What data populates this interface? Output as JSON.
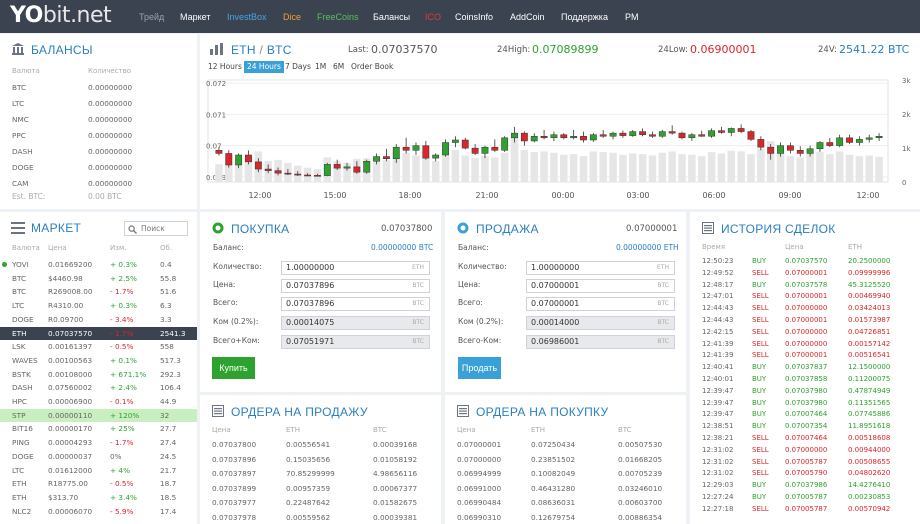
{
  "logo": {
    "yo": "YO",
    "bit": "bit",
    "net": ".net"
  },
  "nav": [
    {
      "label": "Трейд",
      "color": "#9aa0a8"
    },
    {
      "label": "Маркет",
      "color": "#ffffff"
    },
    {
      "label": "InvestBox",
      "color": "#4aa3e0"
    },
    {
      "label": "Dice",
      "color": "#f0a030"
    },
    {
      "label": "FreeCoins",
      "color": "#5ac05a"
    },
    {
      "label": "Балансы",
      "color": "#ffffff"
    },
    {
      "label": "ICO",
      "color": "#e03a3a"
    },
    {
      "label": "CoinsInfo",
      "color": "#ffffff"
    },
    {
      "label": "AddCoin",
      "color": "#ffffff"
    },
    {
      "label": "Поддержка",
      "color": "#ffffff"
    },
    {
      "label": "PM",
      "color": "#ffffff"
    }
  ],
  "balances": {
    "title": "БАЛАНСЫ",
    "col_currency": "Валюта",
    "col_amount": "Количество",
    "rows": [
      {
        "coin": "BTC",
        "amount": "0.00000000"
      },
      {
        "coin": "LTC",
        "amount": "0.00000000"
      },
      {
        "coin": "NMC",
        "amount": "0.00000000"
      },
      {
        "coin": "PPC",
        "amount": "0.00000000"
      },
      {
        "coin": "DASH",
        "amount": "0.00000000"
      },
      {
        "coin": "DOGE",
        "amount": "0.00000000"
      },
      {
        "coin": "CAM",
        "amount": "0.00000000"
      }
    ],
    "est_label": "Est. BTC:",
    "est_value": "0.00 BTC"
  },
  "market": {
    "title": "МАРКЕТ",
    "search_placeholder": "Поиск",
    "headers": [
      "Валюта",
      "Цена",
      "Изм.",
      "Об."
    ],
    "rows": [
      {
        "coin": "YOVI",
        "price": "0.01669200",
        "change": "+ 0.3%",
        "vol": "0.4",
        "dir": "up",
        "hl": ""
      },
      {
        "coin": "BTC",
        "price": "$4460.98",
        "change": "+ 2.5%",
        "vol": "55.8",
        "dir": "up",
        "hl": ""
      },
      {
        "coin": "BTC",
        "price": "R269008.00",
        "change": "- 1.7%",
        "vol": "51.6",
        "dir": "down",
        "hl": ""
      },
      {
        "coin": "LTC",
        "price": "R4310.00",
        "change": "+ 0.3%",
        "vol": "6.3",
        "dir": "up",
        "hl": ""
      },
      {
        "coin": "DOGE",
        "price": "R0.09700",
        "change": "- 3.4%",
        "vol": "3.3",
        "dir": "down",
        "hl": ""
      },
      {
        "coin": "ETH",
        "price": "0.07037570",
        "change": "- 1.7%",
        "vol": "2541.3",
        "dir": "down",
        "hl": "sel"
      },
      {
        "coin": "LSK",
        "price": "0.00161397",
        "change": "- 0.5%",
        "vol": "558",
        "dir": "down",
        "hl": ""
      },
      {
        "coin": "WAVES",
        "price": "0.00100563",
        "change": "+ 0.1%",
        "vol": "517.3",
        "dir": "up",
        "hl": ""
      },
      {
        "coin": "BSTK",
        "price": "0.00108000",
        "change": "+ 671.1%",
        "vol": "292.3",
        "dir": "up",
        "hl": ""
      },
      {
        "coin": "DASH",
        "price": "0.07560002",
        "change": "+ 2.4%",
        "vol": "106.4",
        "dir": "up",
        "hl": ""
      },
      {
        "coin": "HPC",
        "price": "0.00006900",
        "change": "- 0.1%",
        "vol": "44.9",
        "dir": "down",
        "hl": ""
      },
      {
        "coin": "STP",
        "price": "0.00000110",
        "change": "+ 120%",
        "vol": "32",
        "dir": "up",
        "hl": "green"
      },
      {
        "coin": "BIT16",
        "price": "0.00000170",
        "change": "+ 25%",
        "vol": "27.7",
        "dir": "up",
        "hl": ""
      },
      {
        "coin": "PING",
        "price": "0.00004293",
        "change": "- 1.7%",
        "vol": "27.4",
        "dir": "down",
        "hl": ""
      },
      {
        "coin": "DOGE",
        "price": "0.00000037",
        "change": "0%",
        "vol": "24.5",
        "dir": "flat",
        "hl": ""
      },
      {
        "coin": "LTC",
        "price": "0.01612000",
        "change": "+ 4%",
        "vol": "21.7",
        "dir": "up",
        "hl": ""
      },
      {
        "coin": "ETH",
        "price": "R18775.00",
        "change": "- 0.5%",
        "vol": "18.7",
        "dir": "down",
        "hl": ""
      },
      {
        "coin": "ETH",
        "price": "$313.70",
        "change": "+ 3.4%",
        "vol": "18.5",
        "dir": "up",
        "hl": ""
      },
      {
        "coin": "NLC2",
        "price": "0.00006070",
        "change": "- 5.9%",
        "vol": "17.4",
        "dir": "down",
        "hl": ""
      }
    ]
  },
  "ticker": {
    "base": "ETH",
    "slash": "/",
    "quote": "BTC",
    "last_label": "Last:",
    "last_value": "0.07037570",
    "high_label": "24High:",
    "high_value": "0.07089899",
    "low_label": "24Low:",
    "low_value": "0.06900001",
    "vol_label": "24V:",
    "vol_value": "2541.22 BTC"
  },
  "timeframes": [
    {
      "label": "12 Hours",
      "active": false
    },
    {
      "label": "24 Hours",
      "active": true
    },
    {
      "label": "7 Days",
      "active": false
    },
    {
      "label": "1M",
      "active": false
    },
    {
      "label": "6M",
      "active": false
    },
    {
      "label": "Order Book",
      "active": false
    }
  ],
  "chart_data": {
    "type": "candlestick",
    "y_ticks": [
      "0.072",
      "0.071",
      "0.07",
      "0.069"
    ],
    "vol_ticks": [
      "3k",
      "2k",
      "1k",
      "0"
    ],
    "x_ticks": [
      "12:00",
      "15:00",
      "18:00",
      "21:00",
      "00:00",
      "03:00",
      "06:00",
      "09:00",
      "12:00"
    ],
    "ylim": [
      0.0689,
      0.0721
    ],
    "vol_lim": [
      0,
      3000
    ],
    "candles": [
      {
        "o": 0.06985,
        "h": 0.06995,
        "l": 0.06968,
        "c": 0.06975,
        "v": 520
      },
      {
        "o": 0.06975,
        "h": 0.06985,
        "l": 0.0693,
        "c": 0.06938,
        "v": 780
      },
      {
        "o": 0.06938,
        "h": 0.06975,
        "l": 0.06928,
        "c": 0.0697,
        "v": 640
      },
      {
        "o": 0.0697,
        "h": 0.06985,
        "l": 0.0694,
        "c": 0.06948,
        "v": 700
      },
      {
        "o": 0.06948,
        "h": 0.0696,
        "l": 0.06915,
        "c": 0.06925,
        "v": 900
      },
      {
        "o": 0.06925,
        "h": 0.0694,
        "l": 0.06912,
        "c": 0.0692,
        "v": 620
      },
      {
        "o": 0.0692,
        "h": 0.0693,
        "l": 0.06905,
        "c": 0.06912,
        "v": 650
      },
      {
        "o": 0.06912,
        "h": 0.06925,
        "l": 0.06906,
        "c": 0.06909,
        "v": 560
      },
      {
        "o": 0.06909,
        "h": 0.06918,
        "l": 0.06903,
        "c": 0.06906,
        "v": 480
      },
      {
        "o": 0.06906,
        "h": 0.06912,
        "l": 0.06903,
        "c": 0.06905,
        "v": 420
      },
      {
        "o": 0.06905,
        "h": 0.0691,
        "l": 0.06902,
        "c": 0.06904,
        "v": 380
      },
      {
        "o": 0.06904,
        "h": 0.06945,
        "l": 0.06902,
        "c": 0.0694,
        "v": 720
      },
      {
        "o": 0.0694,
        "h": 0.06955,
        "l": 0.06922,
        "c": 0.06928,
        "v": 610
      },
      {
        "o": 0.06928,
        "h": 0.06945,
        "l": 0.0692,
        "c": 0.06932,
        "v": 560
      },
      {
        "o": 0.06932,
        "h": 0.0695,
        "l": 0.0691,
        "c": 0.06915,
        "v": 680
      },
      {
        "o": 0.06915,
        "h": 0.06955,
        "l": 0.0691,
        "c": 0.0695,
        "v": 700
      },
      {
        "o": 0.0695,
        "h": 0.06975,
        "l": 0.0694,
        "c": 0.06965,
        "v": 730
      },
      {
        "o": 0.06965,
        "h": 0.0699,
        "l": 0.0695,
        "c": 0.06958,
        "v": 640
      },
      {
        "o": 0.06958,
        "h": 0.07005,
        "l": 0.06945,
        "c": 0.06995,
        "v": 920
      },
      {
        "o": 0.06995,
        "h": 0.07025,
        "l": 0.06975,
        "c": 0.06985,
        "v": 860
      },
      {
        "o": 0.06985,
        "h": 0.0701,
        "l": 0.0697,
        "c": 0.07,
        "v": 780
      },
      {
        "o": 0.07,
        "h": 0.07015,
        "l": 0.06955,
        "c": 0.0696,
        "v": 740
      },
      {
        "o": 0.0696,
        "h": 0.06975,
        "l": 0.0695,
        "c": 0.0697,
        "v": 620
      },
      {
        "o": 0.0697,
        "h": 0.0702,
        "l": 0.06965,
        "c": 0.0701,
        "v": 980
      },
      {
        "o": 0.0701,
        "h": 0.0703,
        "l": 0.06995,
        "c": 0.07018,
        "v": 940
      },
      {
        "o": 0.07018,
        "h": 0.07025,
        "l": 0.06988,
        "c": 0.06992,
        "v": 780
      },
      {
        "o": 0.06992,
        "h": 0.07005,
        "l": 0.0697,
        "c": 0.06975,
        "v": 700
      },
      {
        "o": 0.06975,
        "h": 0.07,
        "l": 0.0696,
        "c": 0.06995,
        "v": 760
      },
      {
        "o": 0.06995,
        "h": 0.0702,
        "l": 0.0698,
        "c": 0.06985,
        "v": 720
      },
      {
        "o": 0.06985,
        "h": 0.0703,
        "l": 0.0698,
        "c": 0.07025,
        "v": 860
      },
      {
        "o": 0.07025,
        "h": 0.0706,
        "l": 0.0701,
        "c": 0.0704,
        "v": 1350
      },
      {
        "o": 0.0704,
        "h": 0.07045,
        "l": 0.07,
        "c": 0.07015,
        "v": 940
      },
      {
        "o": 0.07015,
        "h": 0.0704,
        "l": 0.0701,
        "c": 0.0703,
        "v": 880
      },
      {
        "o": 0.0703,
        "h": 0.0705,
        "l": 0.0702,
        "c": 0.07025,
        "v": 900
      },
      {
        "o": 0.07025,
        "h": 0.07045,
        "l": 0.07015,
        "c": 0.07035,
        "v": 860
      },
      {
        "o": 0.07035,
        "h": 0.0704,
        "l": 0.0702,
        "c": 0.07025,
        "v": 800
      },
      {
        "o": 0.07025,
        "h": 0.0705,
        "l": 0.0702,
        "c": 0.0703,
        "v": 820
      },
      {
        "o": 0.0703,
        "h": 0.07045,
        "l": 0.0701,
        "c": 0.07018,
        "v": 760
      },
      {
        "o": 0.07018,
        "h": 0.0704,
        "l": 0.07012,
        "c": 0.07035,
        "v": 900
      },
      {
        "o": 0.07035,
        "h": 0.0705,
        "l": 0.07025,
        "c": 0.0703,
        "v": 880
      },
      {
        "o": 0.0703,
        "h": 0.07045,
        "l": 0.0702,
        "c": 0.0704,
        "v": 860
      },
      {
        "o": 0.0704,
        "h": 0.07048,
        "l": 0.07025,
        "c": 0.07032,
        "v": 800
      },
      {
        "o": 0.07032,
        "h": 0.0705,
        "l": 0.07028,
        "c": 0.07045,
        "v": 840
      },
      {
        "o": 0.07045,
        "h": 0.07055,
        "l": 0.0703,
        "c": 0.07035,
        "v": 820
      },
      {
        "o": 0.07035,
        "h": 0.07045,
        "l": 0.07025,
        "c": 0.0703,
        "v": 780
      },
      {
        "o": 0.0703,
        "h": 0.0705,
        "l": 0.07025,
        "c": 0.07045,
        "v": 860
      },
      {
        "o": 0.07045,
        "h": 0.07065,
        "l": 0.07035,
        "c": 0.0704,
        "v": 900
      },
      {
        "o": 0.0704,
        "h": 0.07045,
        "l": 0.0702,
        "c": 0.07025,
        "v": 820
      },
      {
        "o": 0.07025,
        "h": 0.0704,
        "l": 0.07015,
        "c": 0.07035,
        "v": 800
      },
      {
        "o": 0.07035,
        "h": 0.07048,
        "l": 0.07028,
        "c": 0.0703,
        "v": 760
      },
      {
        "o": 0.0703,
        "h": 0.07055,
        "l": 0.07025,
        "c": 0.07048,
        "v": 880
      },
      {
        "o": 0.07048,
        "h": 0.0706,
        "l": 0.07038,
        "c": 0.07042,
        "v": 840
      },
      {
        "o": 0.07042,
        "h": 0.07058,
        "l": 0.0703,
        "c": 0.07055,
        "v": 920
      },
      {
        "o": 0.07055,
        "h": 0.07068,
        "l": 0.0704,
        "c": 0.07045,
        "v": 900
      },
      {
        "o": 0.07045,
        "h": 0.0705,
        "l": 0.07015,
        "c": 0.0702,
        "v": 820
      },
      {
        "o": 0.0702,
        "h": 0.0703,
        "l": 0.06985,
        "c": 0.06995,
        "v": 980
      },
      {
        "o": 0.06995,
        "h": 0.07005,
        "l": 0.06955,
        "c": 0.06975,
        "v": 1200
      },
      {
        "o": 0.06975,
        "h": 0.0701,
        "l": 0.06965,
        "c": 0.07,
        "v": 860
      },
      {
        "o": 0.07,
        "h": 0.0701,
        "l": 0.06975,
        "c": 0.06985,
        "v": 760
      },
      {
        "o": 0.06985,
        "h": 0.06998,
        "l": 0.06965,
        "c": 0.06975,
        "v": 720
      },
      {
        "o": 0.06975,
        "h": 0.07,
        "l": 0.06965,
        "c": 0.0699,
        "v": 840
      },
      {
        "o": 0.0699,
        "h": 0.07015,
        "l": 0.0698,
        "c": 0.0701,
        "v": 880
      },
      {
        "o": 0.0701,
        "h": 0.07025,
        "l": 0.06995,
        "c": 0.07,
        "v": 820
      },
      {
        "o": 0.07,
        "h": 0.07035,
        "l": 0.06995,
        "c": 0.07025,
        "v": 900
      },
      {
        "o": 0.07025,
        "h": 0.07035,
        "l": 0.07005,
        "c": 0.0701,
        "v": 800
      },
      {
        "o": 0.0701,
        "h": 0.0703,
        "l": 0.07,
        "c": 0.0702,
        "v": 760
      },
      {
        "o": 0.0702,
        "h": 0.07035,
        "l": 0.0701,
        "c": 0.07025,
        "v": 780
      },
      {
        "o": 0.07025,
        "h": 0.0704,
        "l": 0.07015,
        "c": 0.0703,
        "v": 740
      }
    ]
  },
  "buy": {
    "title": "ПОКУПКА",
    "price": "0.07037800",
    "balance_label": "Баланс:",
    "balance_value": "0.00000000 BTC",
    "amount_label": "Количество:",
    "amount_value": "1.00000000",
    "amount_unit": "ETH",
    "price_label": "Цена:",
    "price_value": "0.07037896",
    "price_unit": "BTC",
    "total_label": "Всего:",
    "total_value": "0.07037896",
    "total_unit": "BTC",
    "fee_label": "Ком (0.2%):",
    "fee_value": "0.00014075",
    "fee_unit": "BTC",
    "totalfee_label": "Всего+Ком:",
    "totalfee_value": "0.07051971",
    "totalfee_unit": "BTC",
    "button": "Купить"
  },
  "sell": {
    "title": "ПРОДАЖА",
    "price": "0.07000001",
    "balance_label": "Баланс:",
    "balance_value": "0.00000000 ETH",
    "amount_label": "Количество:",
    "amount_value": "1.00000000",
    "amount_unit": "ETH",
    "price_label": "Цена:",
    "price_value": "0.07000001",
    "price_unit": "BTC",
    "total_label": "Всего:",
    "total_value": "0.07000001",
    "total_unit": "BTC",
    "fee_label": "Ком (0.2%):",
    "fee_value": "0.00014000",
    "fee_unit": "BTC",
    "totalfee_label": "Всего-Ком:",
    "totalfee_value": "0.06986001",
    "totalfee_unit": "BTC",
    "button": "Продать"
  },
  "sell_orders": {
    "title": "ОРДЕРА НА ПРОДАЖУ",
    "headers": [
      "Цена",
      "ETH",
      "BTC"
    ],
    "rows": [
      [
        "0.07037800",
        "0.00556541",
        "0.00039168"
      ],
      [
        "0.07037896",
        "0.15035656",
        "0.01058192"
      ],
      [
        "0.07037897",
        "70.85299999",
        "4.98656116"
      ],
      [
        "0.07037899",
        "0.00957359",
        "0.00067377"
      ],
      [
        "0.07037977",
        "0.22487642",
        "0.01582675"
      ],
      [
        "0.07037978",
        "0.00559562",
        "0.00039381"
      ]
    ]
  },
  "buy_orders": {
    "title": "ОРДЕРА НА ПОКУПКУ",
    "headers": [
      "Цена",
      "ETH",
      "BTC"
    ],
    "rows": [
      [
        "0.07000001",
        "0.07250434",
        "0.00507530"
      ],
      [
        "0.07000000",
        "0.23851502",
        "0.01668205"
      ],
      [
        "0.06994999",
        "0.10082049",
        "0.00705239"
      ],
      [
        "0.06991000",
        "0.46431280",
        "0.03246010"
      ],
      [
        "0.06990484",
        "0.08636031",
        "0.00603700"
      ],
      [
        "0.06990310",
        "0.12679754",
        "0.00886354"
      ]
    ]
  },
  "history": {
    "title": "ИСТОРИЯ СДЕЛОК",
    "headers": [
      "Время",
      "",
      "Цена",
      "ETH"
    ],
    "rows": [
      [
        "12:50:23",
        "BUY",
        "0.07037570",
        "20.2500000"
      ],
      [
        "12:49:52",
        "SELL",
        "0.07000001",
        "0.09999996"
      ],
      [
        "12:48:17",
        "BUY",
        "0.07037578",
        "45.3125520"
      ],
      [
        "12:47:01",
        "SELL",
        "0.07000001",
        "0.00469940"
      ],
      [
        "12:44:43",
        "SELL",
        "0.07000000",
        "0.03424013"
      ],
      [
        "12:44:43",
        "SELL",
        "0.07000001",
        "0.01573987"
      ],
      [
        "12:42:15",
        "SELL",
        "0.07000000",
        "0.04726851"
      ],
      [
        "12:41:39",
        "SELL",
        "0.07000000",
        "0.00157142"
      ],
      [
        "12:41:39",
        "SELL",
        "0.07000001",
        "0.00516541"
      ],
      [
        "12:40:41",
        "BUY",
        "0.07037837",
        "12.1500000"
      ],
      [
        "12:40:01",
        "BUY",
        "0.07037858",
        "0.11200075"
      ],
      [
        "12:39:47",
        "BUY",
        "0.07037980",
        "0.47874949"
      ],
      [
        "12:39:47",
        "BUY",
        "0.07037980",
        "0.11351565"
      ],
      [
        "12:39:47",
        "BUY",
        "0.07007464",
        "0.07745886"
      ],
      [
        "12:38:51",
        "BUY",
        "0.07007354",
        "11.8951618"
      ],
      [
        "12:38:21",
        "SELL",
        "0.07007464",
        "0.00518608"
      ],
      [
        "12:31:02",
        "SELL",
        "0.07000000",
        "0.00944000"
      ],
      [
        "12:31:02",
        "SELL",
        "0.07005787",
        "0.00508655"
      ],
      [
        "12:31:02",
        "SELL",
        "0.07005790",
        "0.04802620"
      ],
      [
        "12:29:03",
        "BUY",
        "0.07037986",
        "14.4276410"
      ],
      [
        "12:27:24",
        "BUY",
        "0.07005787",
        "0.00230853"
      ],
      [
        "12:27:18",
        "SELL",
        "0.07005787",
        "0.00570942"
      ]
    ]
  },
  "colors": {
    "topbar": "#3b4351",
    "accent": "#2a7fc1",
    "buy": "#2ea22e",
    "sell": "#d9262a",
    "buy_button": "#2ea22e",
    "sell_button": "#3aa0d8"
  }
}
